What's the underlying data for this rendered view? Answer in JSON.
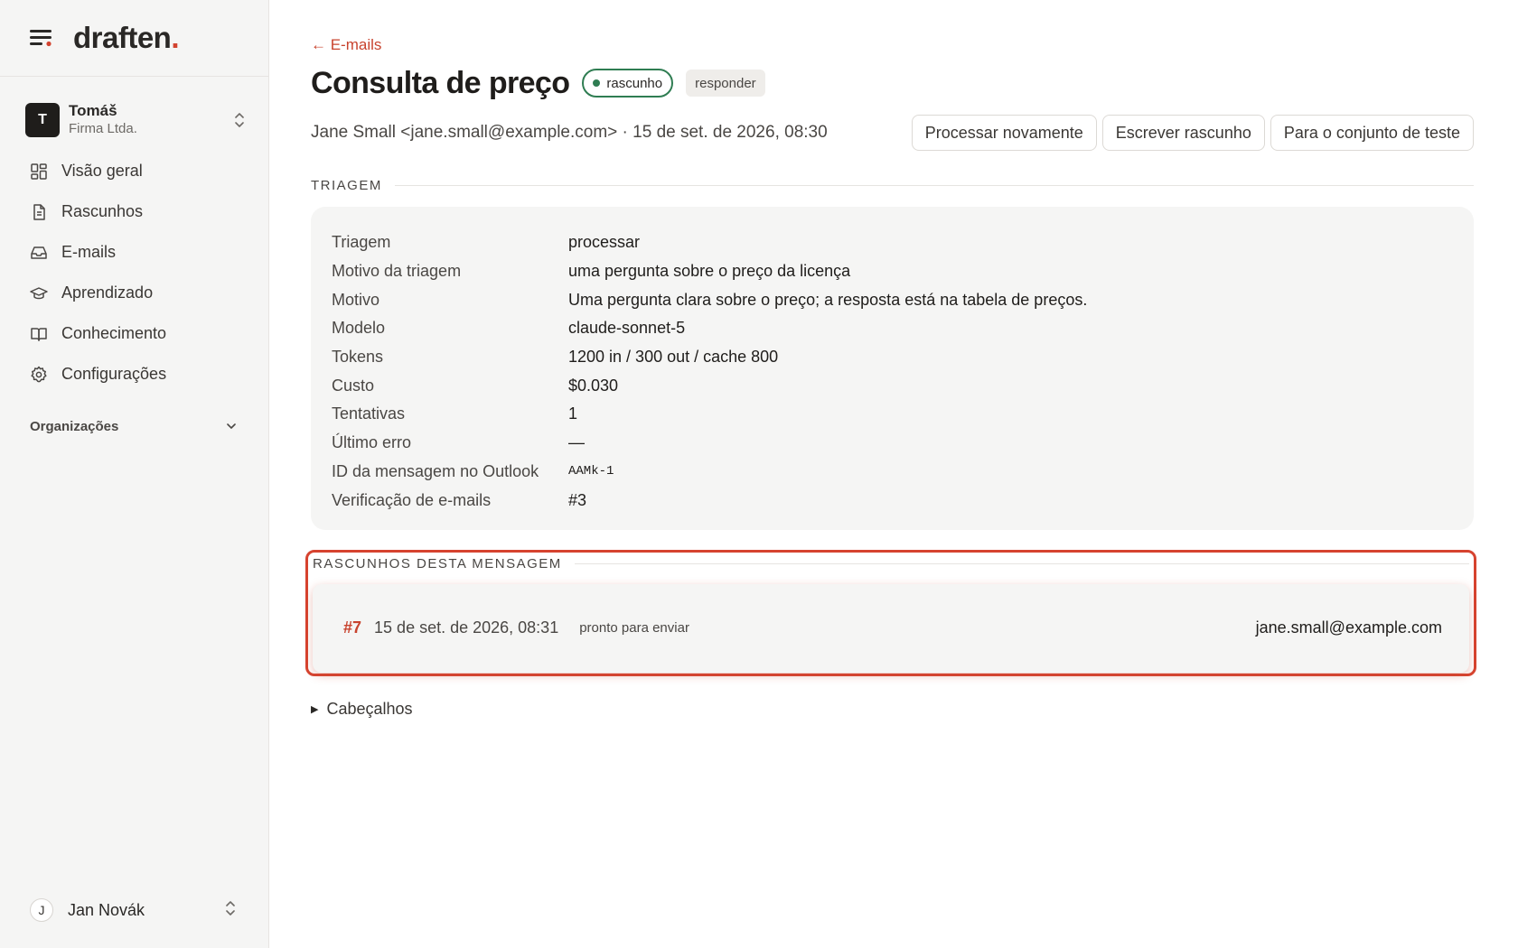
{
  "brand": {
    "name": "draften",
    "dot": "."
  },
  "org": {
    "avatar": "T",
    "name": "Tomáš",
    "subtitle": "Firma Ltda."
  },
  "nav": [
    {
      "label": "Visão geral",
      "icon": "grid-icon"
    },
    {
      "label": "Rascunhos",
      "icon": "document-icon"
    },
    {
      "label": "E-mails",
      "icon": "inbox-icon"
    },
    {
      "label": "Aprendizado",
      "icon": "graduation-cap-icon"
    },
    {
      "label": "Conhecimento",
      "icon": "book-icon"
    },
    {
      "label": "Configurações",
      "icon": "gear-icon"
    }
  ],
  "organizations_label": "Organizações",
  "user": {
    "avatar": "J",
    "name": "Jan Novák"
  },
  "back_link": "← E-mails",
  "page_title": "Consulta de preço",
  "status_badge": "rascunho",
  "type_badge": "responder",
  "meta": "Jane Small <jane.small@example.com> · 15 de set. de 2026, 08:30",
  "actions": {
    "reprocess": "Processar novamente",
    "write_draft": "Escrever rascunho",
    "test_set": "Para o conjunto de teste"
  },
  "triage": {
    "section_title": "TRIAGEM",
    "rows": [
      {
        "key": "Triagem",
        "value": "processar"
      },
      {
        "key": "Motivo da triagem",
        "value": "uma pergunta sobre o preço da licença"
      },
      {
        "key": "Motivo",
        "value": "Uma pergunta clara sobre o preço; a resposta está na tabela de preços."
      },
      {
        "key": "Modelo",
        "value": "claude-sonnet-5"
      },
      {
        "key": "Tokens",
        "value": "1200 in / 300 out / cache 800"
      },
      {
        "key": "Custo",
        "value": "$0.030"
      },
      {
        "key": "Tentativas",
        "value": "1"
      },
      {
        "key": "Último erro",
        "value": "—"
      },
      {
        "key": "ID da mensagem no Outlook",
        "value": "AAMk-1"
      },
      {
        "key": "Verificação de e-mails",
        "value": "#3"
      }
    ]
  },
  "drafts": {
    "section_title": "RASCUNHOS DESTA MENSAGEM",
    "items": [
      {
        "id": "#7",
        "date": "15 de set. de 2026, 08:31",
        "status": "pronto para enviar",
        "email": "jane.small@example.com"
      }
    ]
  },
  "headers_label": "Cabeçalhos",
  "colors": {
    "accent": "#d2432f",
    "success": "#2f7d52",
    "highlight": "#d6432f"
  }
}
